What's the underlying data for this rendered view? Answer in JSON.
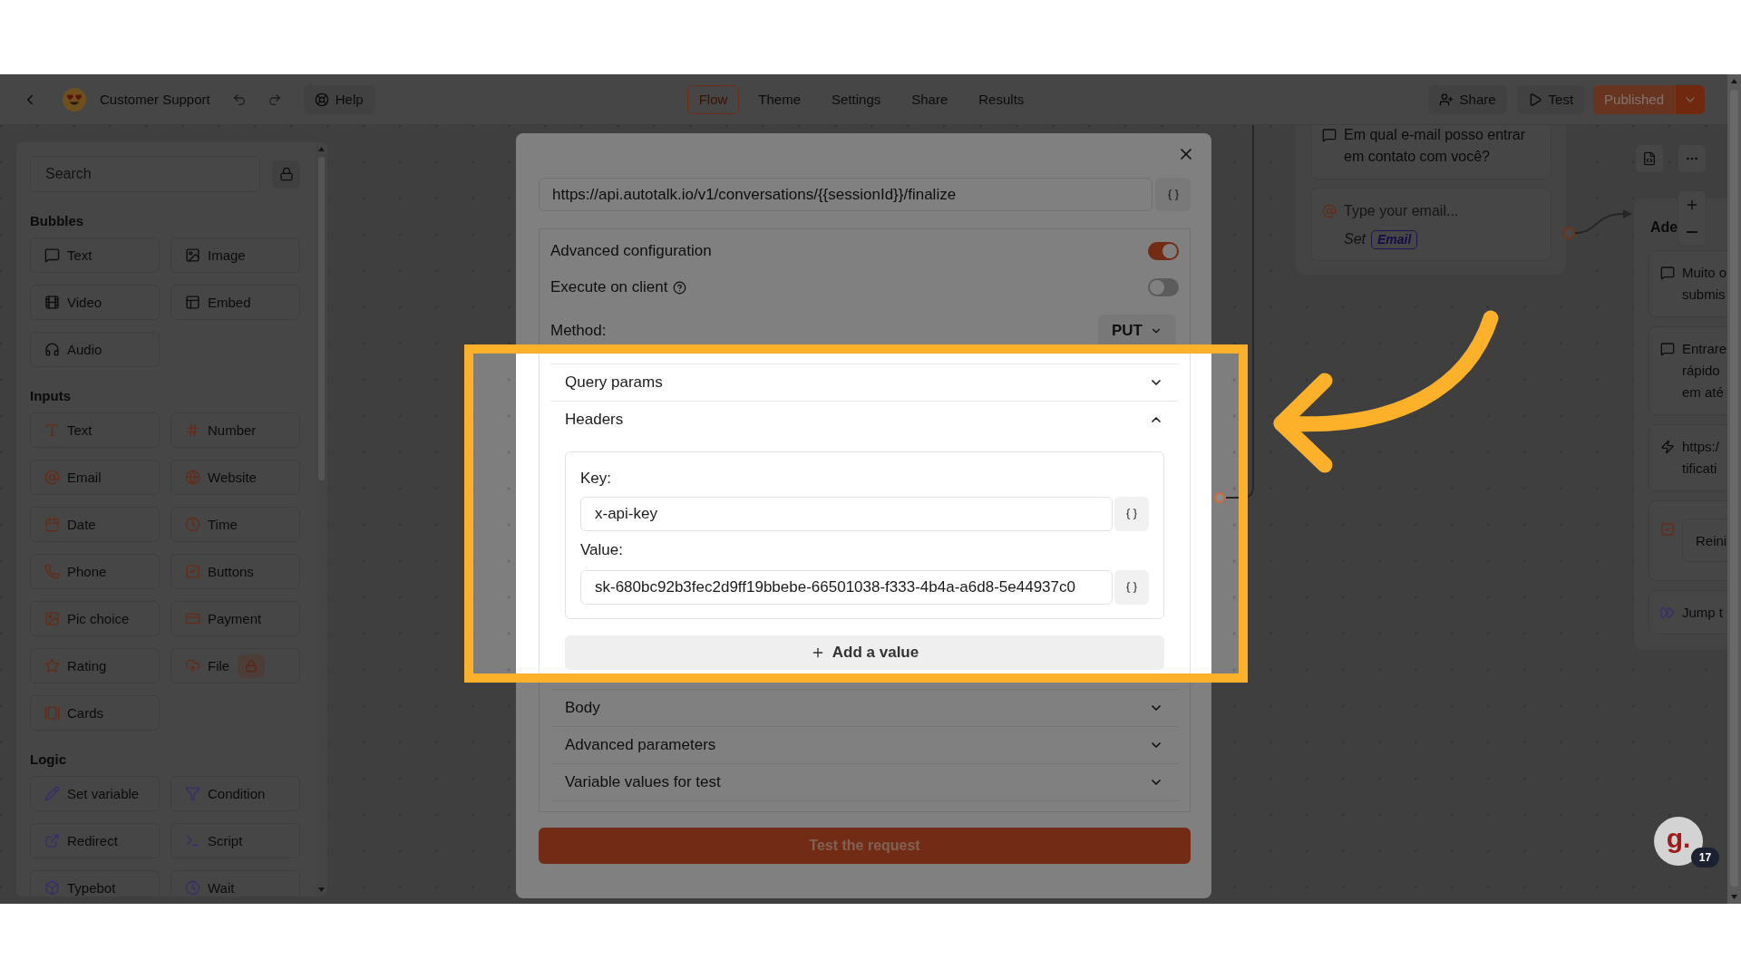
{
  "topbar": {
    "title": "Customer Support",
    "help": "Help",
    "tabs": [
      {
        "label": "Flow",
        "selected": true
      },
      {
        "label": "Theme",
        "selected": false
      },
      {
        "label": "Settings",
        "selected": false
      },
      {
        "label": "Share",
        "selected": false
      },
      {
        "label": "Results",
        "selected": false
      }
    ],
    "actions": [
      {
        "kind": "share",
        "label": "Share"
      },
      {
        "kind": "test",
        "label": "Test"
      }
    ],
    "publish": {
      "label": "Published",
      "disabled": true
    }
  },
  "sidebar": {
    "search": {
      "placeholder": "Search"
    },
    "sections": [
      {
        "title": "Bubbles",
        "kind": "bubbles",
        "items": [
          {
            "label": "Text",
            "locked": false
          },
          {
            "label": "Image",
            "locked": false
          },
          {
            "label": "Video",
            "locked": false
          },
          {
            "label": "Embed",
            "locked": false
          },
          {
            "label": "Audio",
            "locked": false
          }
        ]
      },
      {
        "title": "Inputs",
        "kind": "inputs",
        "items": [
          {
            "label": "Text",
            "locked": false
          },
          {
            "label": "Number",
            "locked": false
          },
          {
            "label": "Email",
            "locked": false
          },
          {
            "label": "Website",
            "locked": false
          },
          {
            "label": "Date",
            "locked": false
          },
          {
            "label": "Time",
            "locked": false
          },
          {
            "label": "Phone",
            "locked": false
          },
          {
            "label": "Buttons",
            "locked": false
          },
          {
            "label": "Pic choice",
            "locked": false
          },
          {
            "label": "Payment",
            "locked": false
          },
          {
            "label": "Rating",
            "locked": false
          },
          {
            "label": "File",
            "locked": true
          },
          {
            "label": "Cards",
            "locked": false
          }
        ]
      },
      {
        "title": "Logic",
        "kind": "logic",
        "items": [
          {
            "label": "Set variable",
            "locked": false
          },
          {
            "label": "Condition",
            "locked": false
          },
          {
            "label": "Redirect",
            "locked": false
          },
          {
            "label": "Script",
            "locked": false
          },
          {
            "label": "Typebot",
            "locked": false
          },
          {
            "label": "Wait",
            "locked": false
          }
        ]
      }
    ]
  },
  "canvas": {
    "groups": [
      {
        "blocks": [
          {
            "kind": "text",
            "lines": [
              "Em qual e-mail posso entrar",
              "em contato com você?"
            ]
          },
          {
            "kind": "email",
            "placeholder": "Type your email...",
            "set_label": "Set",
            "variable": "Email"
          }
        ]
      },
      {
        "title": "Ade",
        "blocks": [
          {
            "kind": "text",
            "lines": [
              "Muito o",
              "submis"
            ]
          },
          {
            "kind": "text",
            "lines": [
              "Entrare",
              "rápido",
              "em até"
            ]
          },
          {
            "kind": "webhook",
            "lines": [
              "https:/",
              "tificati"
            ]
          },
          {
            "kind": "buttons",
            "lines": [
              "Reini"
            ]
          },
          {
            "kind": "jump",
            "lines": [
              "Jump t"
            ]
          }
        ]
      }
    ]
  },
  "modal": {
    "url": "https://api.autotalk.io/v1/conversations/{{sessionId}}/finalize",
    "options": [
      {
        "label": "Advanced configuration",
        "on": true,
        "help": false
      },
      {
        "label": "Execute on client",
        "on": false,
        "help": true
      }
    ],
    "method": {
      "label": "Method:",
      "value": "PUT"
    },
    "sections": [
      {
        "title": "Query params",
        "expanded": false
      },
      {
        "title": "Headers",
        "expanded": true,
        "pairs": [
          {
            "key_label": "Key:",
            "key": "x-api-key",
            "value_label": "Value:",
            "value": "sk-680bc92b3fec2d9ff19bbebe-66501038-f333-4b4a-a6d8-5e44937c0"
          }
        ],
        "add_label": "Add a value"
      },
      {
        "title": "Body",
        "expanded": false
      },
      {
        "title": "Advanced parameters",
        "expanded": false
      },
      {
        "title": "Variable values for test",
        "expanded": false
      }
    ],
    "submit": "Test the request"
  },
  "chat_widget": {
    "logo": "g.",
    "badge": "17"
  }
}
